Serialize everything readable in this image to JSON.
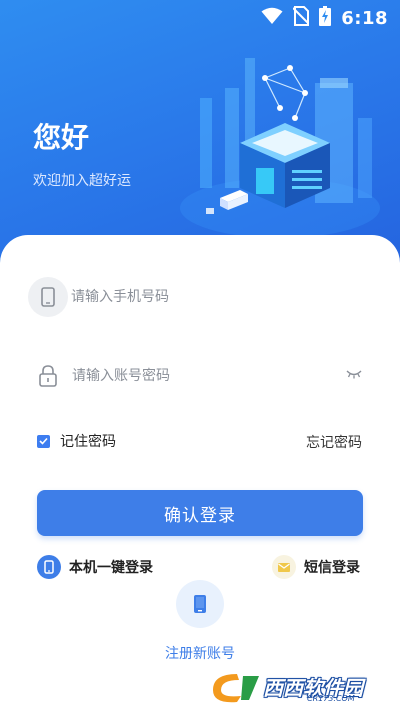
{
  "status_bar": {
    "time": "6:18"
  },
  "header": {
    "greeting": "您好",
    "subtitle": "欢迎加入超好运"
  },
  "form": {
    "phone_placeholder": "请输入手机号码",
    "password_placeholder": "请输入账号密码",
    "remember_label": "记住密码",
    "remember_checked": true,
    "forgot_label": "忘记密码",
    "login_button": "确认登录"
  },
  "alt_login": {
    "one_click_label": "本机一键登录",
    "sms_label": "短信登录"
  },
  "register": {
    "label": "注册新账号"
  },
  "watermark": {
    "text": "西西软件园",
    "url": "CR173.COM"
  },
  "colors": {
    "primary": "#3e7ee8",
    "header_start": "#2f8df0",
    "header_end": "#2462de"
  },
  "icons": [
    "wifi-icon",
    "no-sim-icon",
    "battery-charging-icon",
    "phone-icon",
    "lock-icon",
    "eye-closed-icon",
    "checkbox-icon",
    "mobile-icon",
    "envelope-icon"
  ]
}
